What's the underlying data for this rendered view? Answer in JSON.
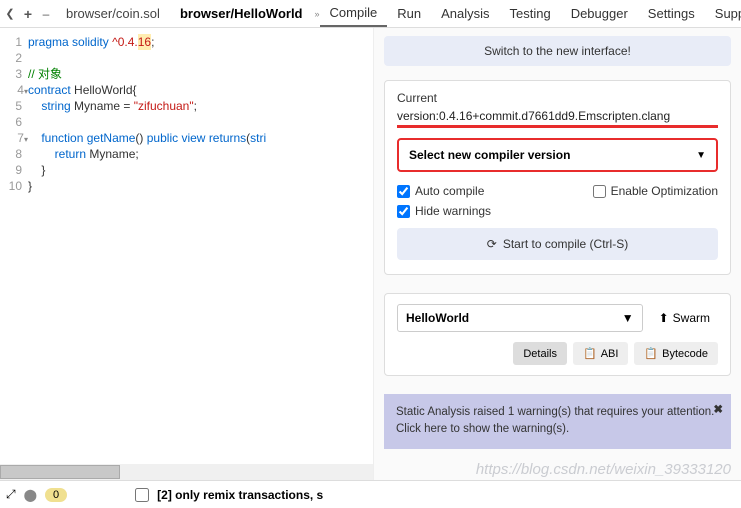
{
  "topbar": {
    "file_tabs": [
      {
        "label": "browser/coin.sol",
        "active": false
      },
      {
        "label": "browser/HelloWorld",
        "active": true
      }
    ],
    "overflow_indicator": "»",
    "menu": [
      "Compile",
      "Run",
      "Analysis",
      "Testing",
      "Debugger",
      "Settings",
      "Supp"
    ]
  },
  "code": {
    "lines": [
      {
        "n": "1",
        "html": "<span class='kw'>pragma</span> <span class='kw'>solidity</span> <span class='str'>^0.4.<span class='hl'>16</span></span>;"
      },
      {
        "n": "2",
        "html": ""
      },
      {
        "n": "3",
        "html": "<span class='com'>// 对象</span>"
      },
      {
        "n": "4",
        "html": "<span class='kw'>contract</span> HelloWorld{",
        "fold": true
      },
      {
        "n": "5",
        "html": "    <span class='ty'>string</span> Myname = <span class='str'>\"zifuchuan\"</span>;"
      },
      {
        "n": "6",
        "html": ""
      },
      {
        "n": "7",
        "html": "    <span class='kw'>function</span> <span class='fn'>getName</span>() <span class='kw'>public</span> <span class='kw'>view</span> <span class='kw'>returns</span>(<span class='ty'>stri</span>",
        "fold": true
      },
      {
        "n": "8",
        "html": "        <span class='kw'>return</span> Myname;"
      },
      {
        "n": "9",
        "html": "    }"
      },
      {
        "n": "10",
        "html": "}"
      }
    ]
  },
  "panel": {
    "switch_banner": "Switch to the new interface!",
    "current_label": "Current",
    "current_version": "version:0.4.16+commit.d7661dd9.Emscripten.clang",
    "select_compiler": "Select new compiler version",
    "auto_compile": "Auto compile",
    "enable_opt": "Enable Optimization",
    "hide_warnings": "Hide warnings",
    "compile_btn": "Start to compile (Ctrl-S)",
    "contract_name": "HelloWorld",
    "swarm": "Swarm",
    "details": "Details",
    "abi": "ABI",
    "bytecode": "Bytecode",
    "warning_line1": "Static Analysis raised 1 warning(s) that requires your attention.",
    "warning_line2": "Click here to show the warning(s).",
    "warning_close": "✖"
  },
  "bottom": {
    "count": "0",
    "msg": "[2] only remix transactions, s"
  },
  "watermark": "https://blog.csdn.net/weixin_39333120"
}
